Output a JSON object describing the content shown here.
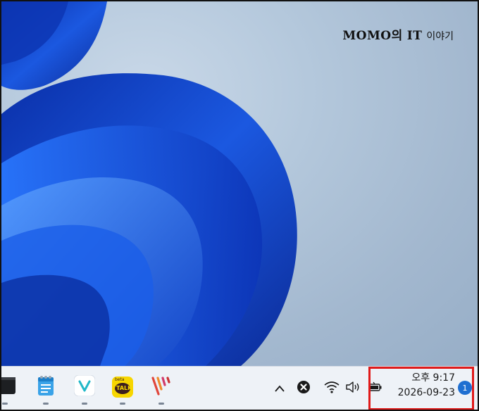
{
  "watermark": {
    "brand": "MOMO의",
    "brand_it": "IT",
    "suffix": "이야기"
  },
  "taskbar": {
    "apps": [
      {
        "name": "terminal",
        "icon": "terminal-icon"
      },
      {
        "name": "notepad",
        "icon": "notepad-icon"
      },
      {
        "name": "vivaldi-style-v",
        "icon": "v-app-icon"
      },
      {
        "name": "kakaotalk",
        "icon": "kakaotalk-icon",
        "label_top": "beta",
        "label": "TALK"
      },
      {
        "name": "stripes-app",
        "icon": "stripes-app-icon"
      }
    ],
    "tray": {
      "chevron": "chevron-up-icon",
      "close": "close-circle-icon",
      "wifi": "wifi-icon",
      "volume": "volume-icon",
      "battery": "battery-icon"
    },
    "clock": {
      "time": "오후 9:17",
      "date": "2026-09-23"
    },
    "notification_count": "1"
  },
  "colors": {
    "highlight": "#e01a1a",
    "badge": "#1f6fd1",
    "bloom": "#1446c8"
  }
}
